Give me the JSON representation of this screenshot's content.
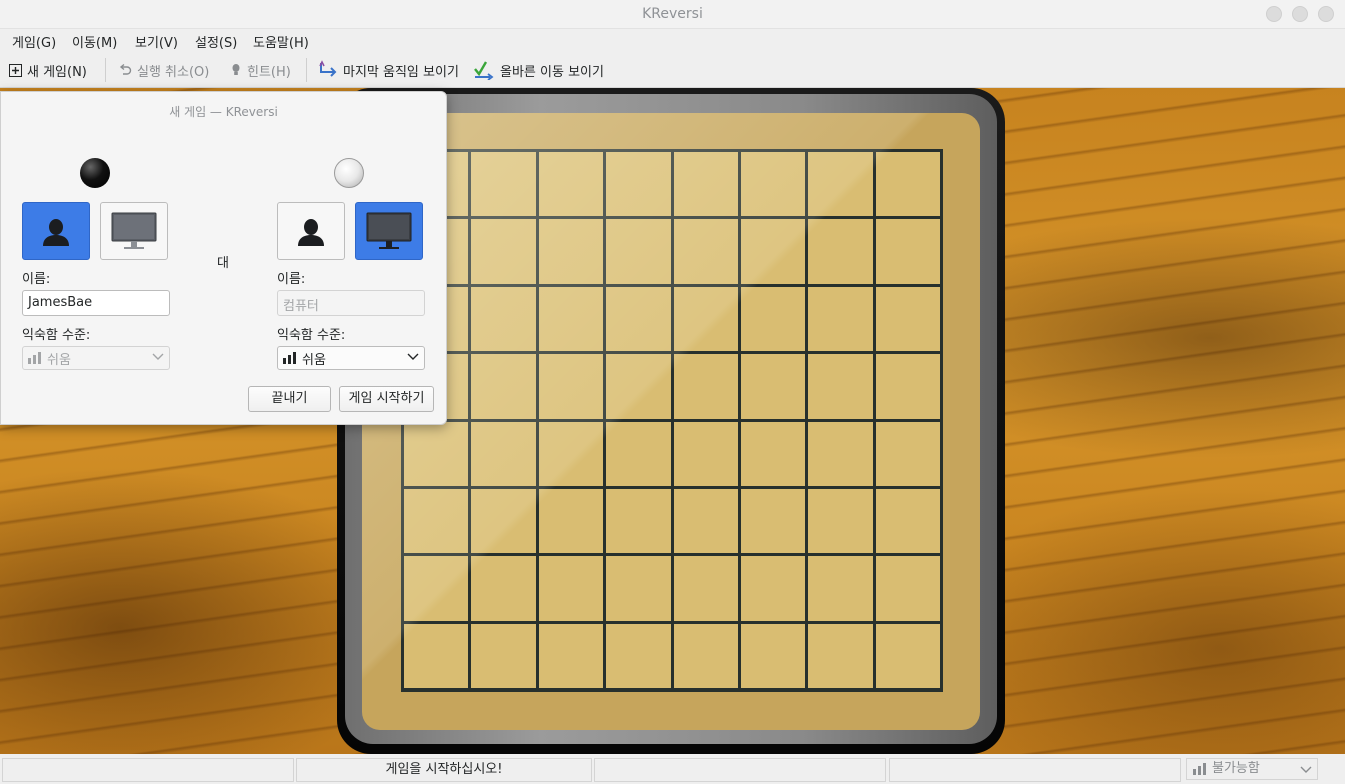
{
  "window": {
    "title": "KReversi"
  },
  "menu": {
    "items": [
      "게임(G)",
      "이동(M)",
      "보기(V)",
      "설정(S)",
      "도움말(H)"
    ]
  },
  "toolbar": {
    "new_game": "새 게임(N)",
    "undo": "실행 취소(O)",
    "hint": "힌트(H)",
    "last_move": "마지막 움직임 보이기",
    "legal_moves": "올바른 이동 보이기"
  },
  "dialog": {
    "title": "새 게임 — KReversi",
    "vs_label": "대",
    "player1": {
      "stone": "black",
      "type_selected": "human",
      "name_label": "이름:",
      "name_value": "JamesBae",
      "skill_label": "익숙함 수준:",
      "skill_value": "쉬움",
      "skill_enabled": false
    },
    "player2": {
      "stone": "white",
      "type_selected": "computer",
      "name_label": "이름:",
      "name_placeholder": "컴퓨터",
      "skill_label": "익숙함 수준:",
      "skill_value": "쉬움",
      "skill_enabled": true
    },
    "buttons": {
      "quit": "끝내기",
      "start": "게임 시작하기"
    }
  },
  "status": {
    "message": "게임을 시작하십시오!",
    "difficulty": "불가능함"
  },
  "colors": {
    "accent": "#3d7ce7",
    "board_cell": "#d9bd72",
    "grid_line": "#27302d",
    "wood": "#c98520"
  },
  "icons": [
    "new-game-icon",
    "undo-icon",
    "hint-icon",
    "last-move-icon",
    "legal-moves-icon",
    "human-icon",
    "computer-icon",
    "skill-bars-icon",
    "chevron-down-icon"
  ]
}
